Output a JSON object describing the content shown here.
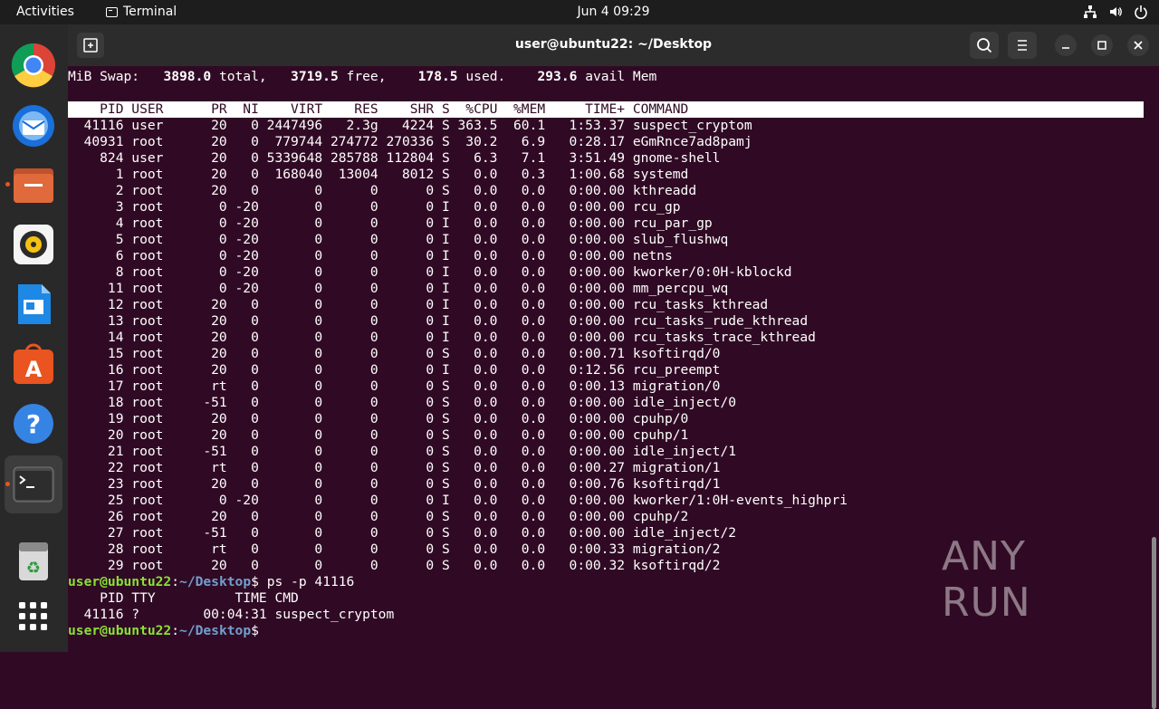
{
  "topbar": {
    "activities": "Activities",
    "app_name": "Terminal",
    "clock": "Jun 4  09:29"
  },
  "window": {
    "title": "user@ubuntu22: ~/Desktop"
  },
  "swap_line": {
    "prefix": "MiB Swap:",
    "total": "3898.0",
    "total_label": "total,",
    "free": "3719.5",
    "free_label": "free,",
    "used": "178.5",
    "used_label": "used.",
    "avail": "293.6",
    "avail_label": "avail Mem"
  },
  "table_header": "    PID USER      PR  NI    VIRT    RES    SHR S  %CPU  %MEM     TIME+ COMMAND",
  "processes": [
    "  41116 user      20   0 2447496   2.3g   4224 S 363.5  60.1   1:53.37 suspect_cryptom",
    "  40931 root      20   0  779744 274772 270336 S  30.2   6.9   0:28.17 eGmRnce7ad8pamj",
    "    824 user      20   0 5339648 285788 112804 S   6.3   7.1   3:51.49 gnome-shell",
    "      1 root      20   0  168040  13004   8012 S   0.0   0.3   1:00.68 systemd",
    "      2 root      20   0       0      0      0 S   0.0   0.0   0:00.00 kthreadd",
    "      3 root       0 -20       0      0      0 I   0.0   0.0   0:00.00 rcu_gp",
    "      4 root       0 -20       0      0      0 I   0.0   0.0   0:00.00 rcu_par_gp",
    "      5 root       0 -20       0      0      0 I   0.0   0.0   0:00.00 slub_flushwq",
    "      6 root       0 -20       0      0      0 I   0.0   0.0   0:00.00 netns",
    "      8 root       0 -20       0      0      0 I   0.0   0.0   0:00.00 kworker/0:0H-kblockd",
    "     11 root       0 -20       0      0      0 I   0.0   0.0   0:00.00 mm_percpu_wq",
    "     12 root      20   0       0      0      0 I   0.0   0.0   0:00.00 rcu_tasks_kthread",
    "     13 root      20   0       0      0      0 I   0.0   0.0   0:00.00 rcu_tasks_rude_kthread",
    "     14 root      20   0       0      0      0 I   0.0   0.0   0:00.00 rcu_tasks_trace_kthread",
    "     15 root      20   0       0      0      0 S   0.0   0.0   0:00.71 ksoftirqd/0",
    "     16 root      20   0       0      0      0 I   0.0   0.0   0:12.56 rcu_preempt",
    "     17 root      rt   0       0      0      0 S   0.0   0.0   0:00.13 migration/0",
    "     18 root     -51   0       0      0      0 S   0.0   0.0   0:00.00 idle_inject/0",
    "     19 root      20   0       0      0      0 S   0.0   0.0   0:00.00 cpuhp/0",
    "     20 root      20   0       0      0      0 S   0.0   0.0   0:00.00 cpuhp/1",
    "     21 root     -51   0       0      0      0 S   0.0   0.0   0:00.00 idle_inject/1",
    "     22 root      rt   0       0      0      0 S   0.0   0.0   0:00.27 migration/1",
    "     23 root      20   0       0      0      0 S   0.0   0.0   0:00.76 ksoftirqd/1",
    "     25 root       0 -20       0      0      0 I   0.0   0.0   0:00.00 kworker/1:0H-events_highpri",
    "     26 root      20   0       0      0      0 S   0.0   0.0   0:00.00 cpuhp/2",
    "     27 root     -51   0       0      0      0 S   0.0   0.0   0:00.00 idle_inject/2",
    "     28 root      rt   0       0      0      0 S   0.0   0.0   0:00.33 migration/2",
    "     29 root      20   0       0      0      0 S   0.0   0.0   0:00.32 ksoftirqd/2"
  ],
  "prompt": {
    "user": "user@ubuntu22",
    "sep": ":",
    "path": "~/Desktop",
    "dollar": "$"
  },
  "command1": " ps -p 41116",
  "ps_header": "    PID TTY          TIME CMD",
  "ps_row": "  41116 ?        00:04:31 suspect_cryptom",
  "watermark": "ANY RUN",
  "dock": [
    "chrome-icon",
    "thunderbird-icon",
    "files-icon",
    "rhythmbox-icon",
    "writer-icon",
    "app-center-icon",
    "help-icon",
    "terminal-icon",
    "trash-icon",
    "show-apps-icon"
  ]
}
